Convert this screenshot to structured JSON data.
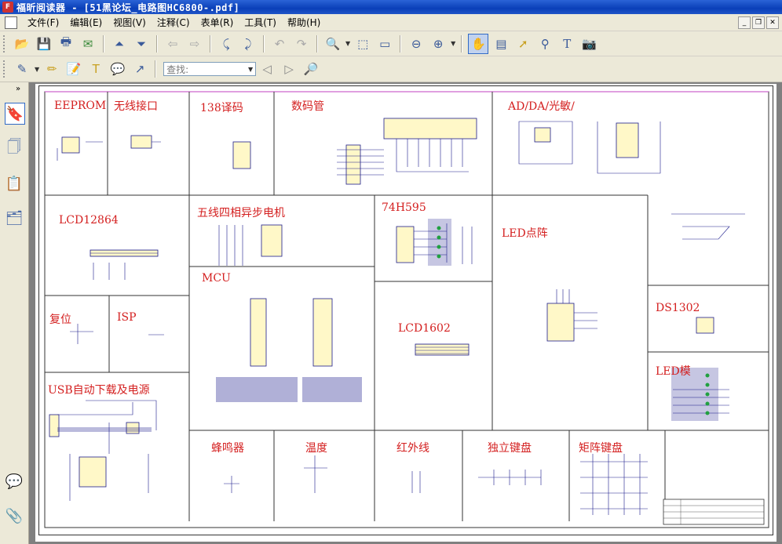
{
  "window": {
    "title": "福昕阅读器 - [51黑论坛_电路图HC6800-.pdf]"
  },
  "menu": [
    "文件(F)",
    "编辑(E)",
    "视图(V)",
    "注释(C)",
    "表单(R)",
    "工具(T)",
    "帮助(H)"
  ],
  "search": {
    "placeholder": "查找:"
  },
  "schematic": {
    "labels": {
      "eeprom": "EEPROM",
      "wireless": "无线接口",
      "decoder138": "138译码",
      "digitube": "数码管",
      "adda": "AD/DA/光敏/",
      "lcd12864": "LCD12864",
      "stepper": "五线四相异步电机",
      "hc595": "74H595",
      "ledmatrix": "LED点阵",
      "mcu": "MCU",
      "reset": "复位",
      "isp": "ISP",
      "ds1302": "DS1302",
      "lcd1602": "LCD1602",
      "ledmod": "LED模",
      "usb": "USB自动下载及电源",
      "buzzer": "蜂鸣器",
      "temp": "温度",
      "infrared": "红外线",
      "keys": "独立键盘",
      "matrixkeys": "矩阵键盘"
    }
  },
  "colors": {
    "label": "#d42020",
    "titlebar": "#0a3fb8",
    "wire": "#1c1c8c",
    "component": "#fff8c8"
  }
}
